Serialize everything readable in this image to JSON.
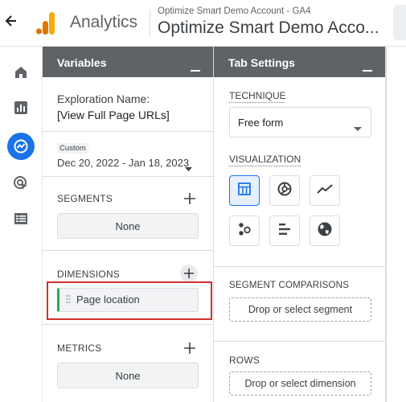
{
  "header": {
    "app_name": "Analytics",
    "account_sub": "Optimize Smart Demo Account - GA4",
    "account_main": "Optimize Smart Demo Acco..."
  },
  "colors": {
    "accent": "#1a73e8",
    "panel_header": "#5f6368",
    "highlight_box": "#d32f2f",
    "chip_accent": "#34a853"
  },
  "rail": {
    "items": [
      {
        "icon": "home-icon"
      },
      {
        "icon": "bar-chart-icon"
      },
      {
        "icon": "explore-icon"
      },
      {
        "icon": "advertising-icon"
      },
      {
        "icon": "list-icon"
      }
    ]
  },
  "variables": {
    "title": "Variables",
    "exploration_label": "Exploration Name:",
    "exploration_value": "[View Full Page URLs]",
    "date_badge": "Custom",
    "date_range": "Dec 20, 2022 - Jan 18, 2023",
    "segments_label": "SEGMENTS",
    "segments_value": "None",
    "dimensions_label": "DIMENSIONS",
    "dimension_chip": "Page location",
    "metrics_label": "METRICS",
    "metrics_value": "None"
  },
  "tab_settings": {
    "title": "Tab Settings",
    "technique_label": "TECHNIQUE",
    "technique_value": "Free form",
    "visualization_label": "VISUALIZATION",
    "visualizations": [
      {
        "icon": "table-icon",
        "active": true
      },
      {
        "icon": "donut-chart-icon",
        "active": false
      },
      {
        "icon": "line-chart-icon",
        "active": false
      },
      {
        "icon": "scatter-icon",
        "active": false
      },
      {
        "icon": "bar-icon",
        "active": false
      },
      {
        "icon": "globe-icon",
        "active": false
      }
    ],
    "segment_comparisons_label": "SEGMENT COMPARISONS",
    "segment_drop": "Drop or select segment",
    "rows_label": "ROWS",
    "rows_drop": "Drop or select dimension"
  }
}
